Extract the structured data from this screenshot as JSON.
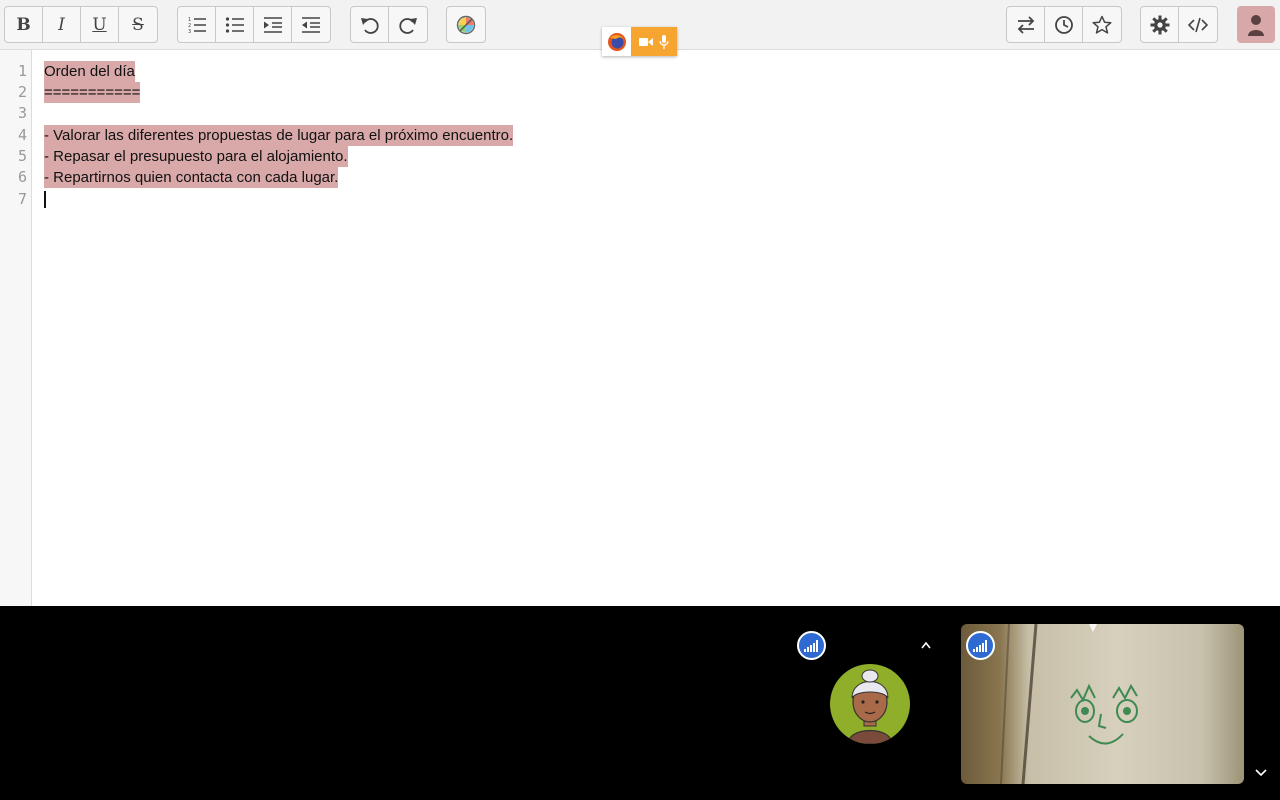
{
  "toolbar": {
    "format": [
      {
        "name": "bold-button",
        "glyph": "B"
      },
      {
        "name": "italic-button",
        "glyph": "I"
      },
      {
        "name": "underline-button",
        "glyph": "U"
      },
      {
        "name": "strikethrough-button",
        "glyph": "S"
      }
    ],
    "list_icons": [
      "numbered-list-icon",
      "bullet-list-icon",
      "indent-icon",
      "outdent-icon"
    ],
    "history_icons": [
      "undo-icon",
      "redo-icon"
    ],
    "color_icon": "color-palette-icon",
    "right_icons": [
      "import-export-icon",
      "history-clock-icon",
      "star-icon"
    ],
    "settings_icons": [
      "settings-gear-icon",
      "embed-code-icon"
    ],
    "user_icon": "user-avatar-icon"
  },
  "share_indicator": {
    "browser_icon": "firefox-icon",
    "camera_icon": "video-camera-icon",
    "mic_icon": "microphone-icon",
    "accent": "#f7a531"
  },
  "editor": {
    "line_numbers": [
      "1",
      "2",
      "3",
      "4",
      "5",
      "6",
      "7"
    ],
    "lines": [
      "Orden del día",
      "===========",
      "",
      "- Valorar las diferentes propuestas de lugar para el próximo encuentro.",
      "- Repasar el presupuesto para el alojamiento.",
      "- Repartirnos quien contacta con cada lugar.",
      ""
    ],
    "highlight_color": "#d9a9a9"
  },
  "video": {
    "participant_icon": "participant-avatar-icon",
    "signal_icon": "connection-signal-icon",
    "expand_icon": "caret-up-icon",
    "collapse_icon": "chevron-down-icon",
    "avatar_bg": "#8fae2a",
    "signal_color": "#2e6ad1"
  }
}
